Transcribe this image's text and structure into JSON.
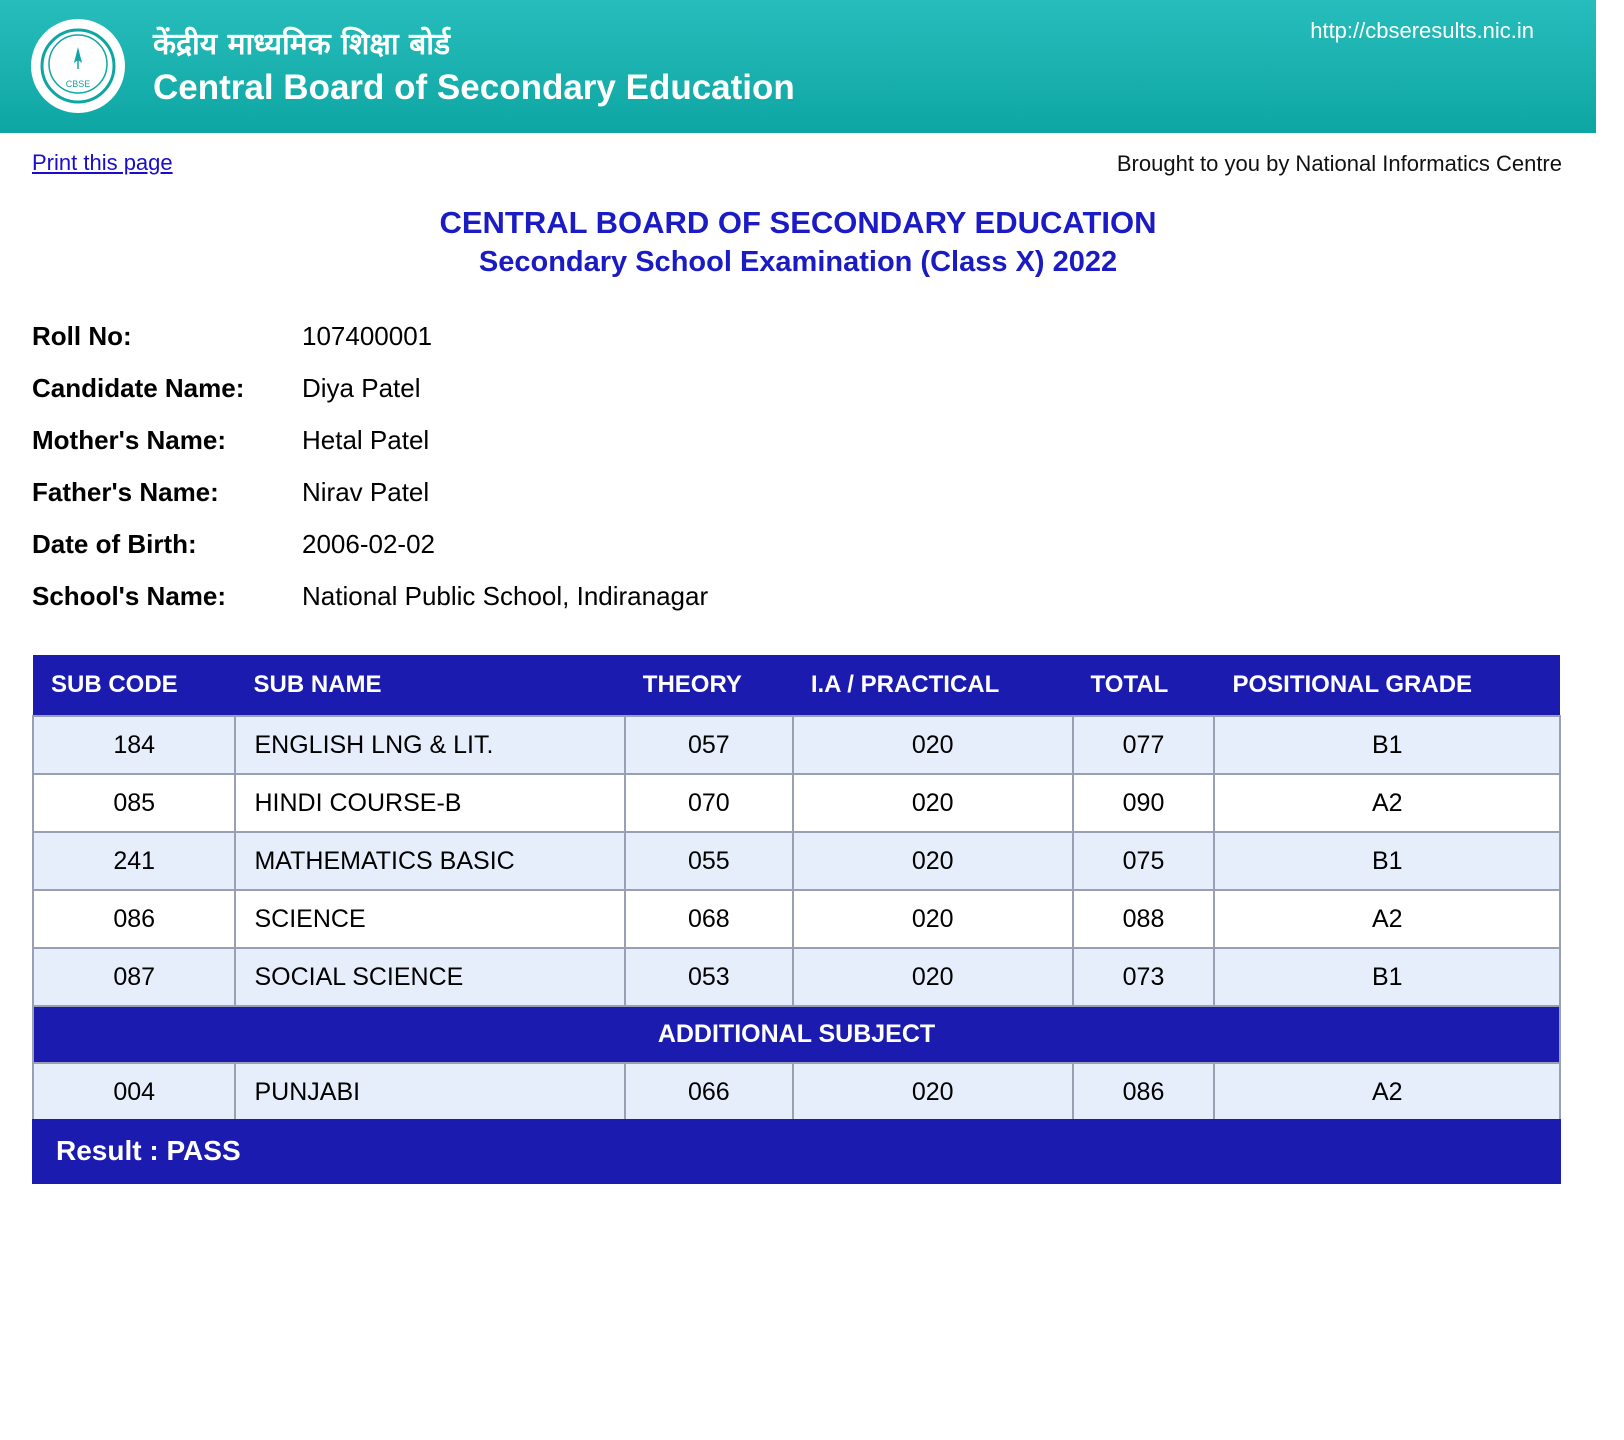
{
  "header": {
    "hindi_title": "केंद्रीय माध्यमिक शिक्षा बोर्ड",
    "english_title": "Central Board of Secondary Education",
    "url": "http://cbseresults.nic.in",
    "logo_text": "CBSE",
    "colors": {
      "header_bg": "#19b3b1",
      "header_text": "#ffffff"
    }
  },
  "toolbar": {
    "print_label": "Print this page",
    "credit": "Brought to you by National Informatics Centre"
  },
  "titles": {
    "main": "CENTRAL BOARD OF SECONDARY EDUCATION",
    "sub": "Secondary School Examination (Class X) 2022"
  },
  "candidate": [
    {
      "label": "Roll No:",
      "value": "107400001"
    },
    {
      "label": "Candidate Name:",
      "value": "Diya Patel"
    },
    {
      "label": "Mother's Name:",
      "value": "Hetal Patel"
    },
    {
      "label": "Father's Name:",
      "value": "Nirav Patel"
    },
    {
      "label": "Date of Birth:",
      "value": "2006-02-02"
    },
    {
      "label": "School's Name:",
      "value": "National Public School, Indiranagar"
    }
  ],
  "table": {
    "headers": [
      "SUB CODE",
      "SUB NAME",
      "THEORY",
      "I.A / PRACTICAL",
      "TOTAL",
      "POSITIONAL GRADE"
    ],
    "rows": [
      [
        "184",
        "ENGLISH LNG & LIT.",
        "057",
        "020",
        "077",
        "B1"
      ],
      [
        "085",
        "HINDI COURSE-B",
        "070",
        "020",
        "090",
        "A2"
      ],
      [
        "241",
        "MATHEMATICS BASIC",
        "055",
        "020",
        "075",
        "B1"
      ],
      [
        "086",
        "SCIENCE",
        "068",
        "020",
        "088",
        "A2"
      ],
      [
        "087",
        "SOCIAL SCIENCE",
        "053",
        "020",
        "073",
        "B1"
      ]
    ],
    "additional_label": "ADDITIONAL SUBJECT",
    "additional_rows": [
      [
        "004",
        "PUNJABI",
        "066",
        "020",
        "086",
        "A2"
      ]
    ],
    "colors": {
      "header_bg": "#1b1bb0",
      "row_alt": "#e7eefb",
      "border": "#9aa0b4"
    }
  },
  "result": {
    "text": "Result : PASS"
  }
}
